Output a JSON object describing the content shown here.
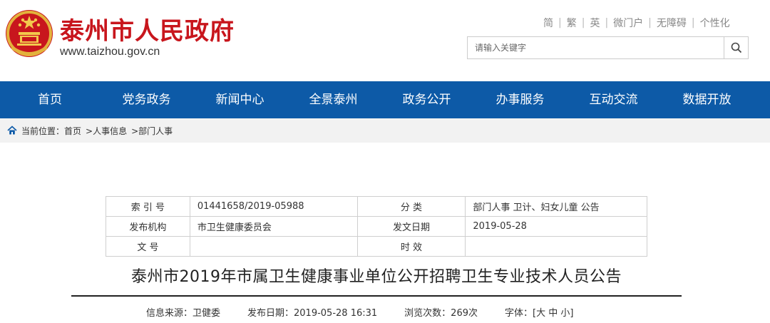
{
  "header": {
    "site_title": "泰州市人民政府",
    "site_url": "www.taizhou.gov.cn",
    "brand_color": "#c8161d",
    "top_links": [
      "简",
      "繁",
      "英",
      "微门户",
      "无障碍",
      "个性化"
    ],
    "search_placeholder": "请输入关键字"
  },
  "nav": {
    "bg_color": "#0d5aa7",
    "items": [
      "首页",
      "党务政务",
      "新闻中心",
      "全景泰州",
      "政务公开",
      "办事服务",
      "互动交流",
      "数据开放"
    ]
  },
  "breadcrumb": {
    "label": "当前位置：",
    "items": [
      "首页",
      ">人事信息",
      ">部门人事"
    ]
  },
  "meta": {
    "index_label": "索 引 号",
    "index_value": "01441658/2019-05988",
    "category_label": "分 类",
    "category_value": "部门人事 卫计、妇女儿童 公告",
    "publisher_label": "发布机构",
    "publisher_value": "市卫生健康委员会",
    "date_label": "发文日期",
    "date_value": "2019-05-28",
    "docno_label": "文 号",
    "docno_value": "",
    "validity_label": "时 效",
    "validity_value": ""
  },
  "article": {
    "title": "泰州市2019年市属卫生健康事业单位公开招聘卫生专业技术人员公告",
    "source": "信息来源：卫健委",
    "publish_date": "发布日期：2019-05-28 16:31",
    "views": "浏览次数：269次",
    "font_label": "字体：[",
    "font_large": "大",
    "font_medium": "中",
    "font_small": "小",
    "font_end": "]"
  }
}
